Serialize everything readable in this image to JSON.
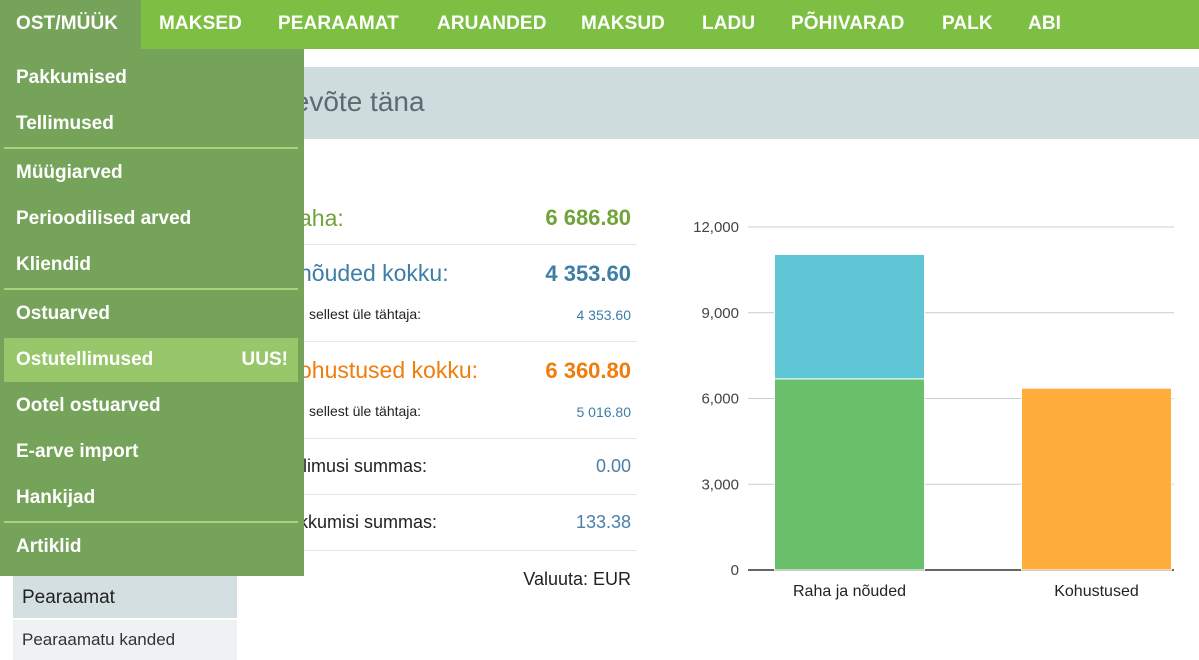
{
  "topnav": {
    "items": [
      "OST/MÜÜK",
      "MAKSED",
      "PEARAAMAT",
      "ARUANDED",
      "MAKSUD",
      "LADU",
      "PÕHIVARAD",
      "PALK",
      "ABI"
    ],
    "active_index": 0
  },
  "dropdown": {
    "items": [
      {
        "label": "Pakkumised"
      },
      {
        "label": "Tellimused"
      },
      {
        "label": "Müügiarved"
      },
      {
        "label": "Perioodilised arved"
      },
      {
        "label": "Kliendid"
      },
      {
        "label": "Ostuarved"
      },
      {
        "label": "Ostutellimused",
        "badge": "UUS!"
      },
      {
        "label": "Ootel ostuarved"
      },
      {
        "label": "E-arve import"
      },
      {
        "label": "Hankijad"
      },
      {
        "label": "Artiklid"
      }
    ]
  },
  "page": {
    "title": "tevõte täna"
  },
  "summary": {
    "raha": {
      "label": "aha:",
      "value": "6 686.80"
    },
    "nouded": {
      "label": "nõuded kokku:",
      "value": "4 353.60"
    },
    "nouded_over": {
      "label": "sellest üle tähtaja:",
      "value": "4 353.60"
    },
    "kohustused": {
      "label": "ohustused kokku:",
      "value": "6 360.80"
    },
    "kohustused_over": {
      "label": "sellest üle tähtaja:",
      "value": "5 016.80"
    },
    "tellimusi": {
      "label": "llimusi summas:",
      "value": "0.00"
    },
    "pakkumisi": {
      "label": "kkumisi summas:",
      "value": "133.38"
    },
    "currency": "Valuuta: EUR"
  },
  "leftnav": {
    "section": "Pearaamat",
    "item": "Pearaamatu kanded"
  },
  "chart_data": {
    "type": "bar",
    "stacked": true,
    "categories": [
      "Raha ja nõuded",
      "Kohustused"
    ],
    "series": [
      {
        "values": [
          6686.8,
          0
        ],
        "color": "#6abf6a"
      },
      {
        "values": [
          4353.6,
          0
        ],
        "color": "#5fc6d5"
      },
      {
        "values": [
          0,
          6360.8
        ],
        "color": "#ffad3b"
      }
    ],
    "yticks": [
      "0",
      "3,000",
      "6,000",
      "9,000",
      "12,000"
    ],
    "ylim": [
      0,
      12000
    ],
    "grid": true
  }
}
